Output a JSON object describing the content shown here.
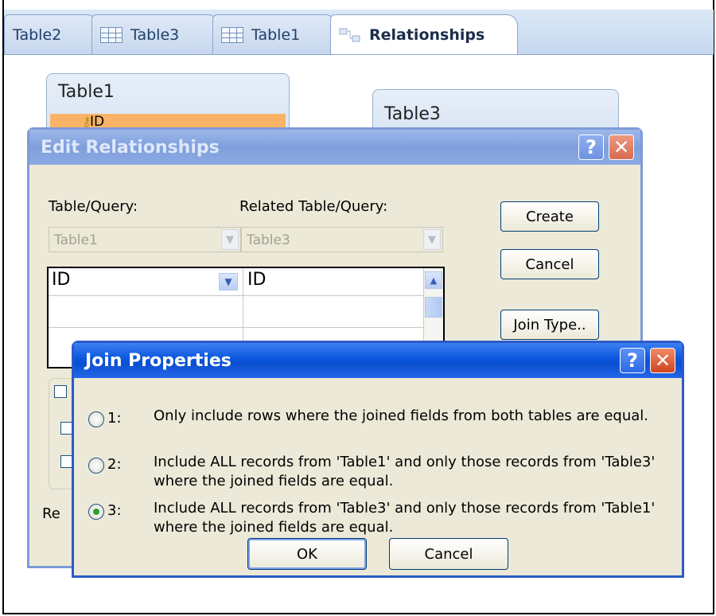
{
  "tabs": [
    {
      "label": "Table2",
      "icon": "none"
    },
    {
      "label": "Table3",
      "icon": "table-icon"
    },
    {
      "label": "Table1",
      "icon": "table-icon"
    },
    {
      "label": "Relationships",
      "icon": "relationships-icon"
    }
  ],
  "canvas": {
    "table1": {
      "title": "Table1",
      "field": "ID"
    },
    "table3": {
      "title": "Table3"
    }
  },
  "edit_dialog": {
    "title": "Edit Relationships",
    "help": "?",
    "close": "✕",
    "table_query_label": "Table/Query:",
    "related_label": "Related Table/Query:",
    "table_value": "Table1",
    "related_value": "Table3",
    "grid_left": "ID",
    "grid_right": "ID",
    "create": "Create",
    "cancel": "Cancel",
    "join_type": "Join Type..",
    "bottom_label": "Re"
  },
  "join_dialog": {
    "title": "Join Properties",
    "help": "?",
    "close": "✕",
    "options": [
      {
        "num": "1:",
        "text": "Only include rows where the joined fields from both tables are equal.",
        "selected": false
      },
      {
        "num": "2:",
        "text": "Include ALL records from 'Table1' and only those records from 'Table3' where the joined fields are equal.",
        "selected": false
      },
      {
        "num": "3:",
        "text": "Include ALL records from 'Table3' and only those records from 'Table1' where the joined fields are equal.",
        "selected": true
      }
    ],
    "ok": "OK",
    "cancel": "Cancel"
  }
}
